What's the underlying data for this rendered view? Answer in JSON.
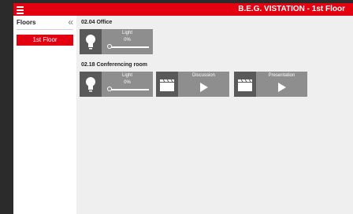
{
  "header": {
    "title": "B.E.G. VISTATION - 1st Floor",
    "menu_icon": "hamburger-icon"
  },
  "sidebar": {
    "title": "Floors",
    "collapse_icon": "chevron-double-left-icon",
    "items": [
      {
        "label": "1st Floor",
        "selected": true
      }
    ]
  },
  "rooms": [
    {
      "name": "02.04 Office",
      "tiles": [
        {
          "type": "dimmer",
          "label": "Light",
          "value": "0%",
          "level": 0
        }
      ]
    },
    {
      "name": "02.18 Conferencing room",
      "tiles": [
        {
          "type": "dimmer",
          "label": "Light",
          "value": "0%",
          "level": 0
        },
        {
          "type": "scene",
          "label": "Discussion",
          "icon": "clapperboard-icon"
        },
        {
          "type": "scene",
          "label": "Presentation",
          "icon": "clapperboard-icon"
        }
      ]
    }
  ],
  "colors": {
    "accent": "#e3000f",
    "tile": "#8e8e8e",
    "tile_icon_bg": "#595959",
    "background": "#efefef"
  }
}
